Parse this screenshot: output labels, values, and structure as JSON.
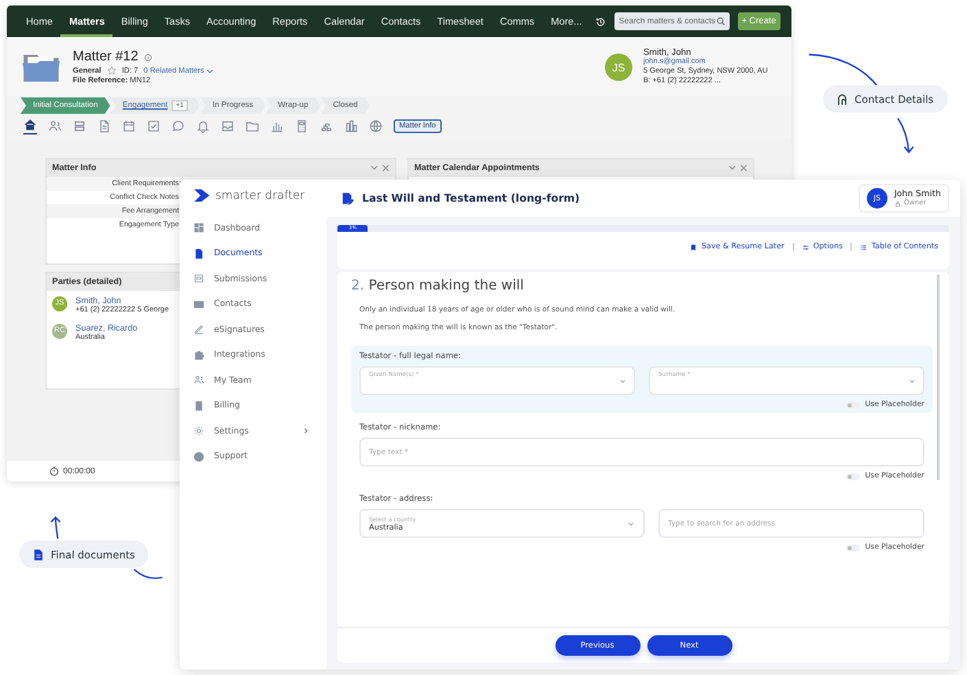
{
  "crm": {
    "nav": [
      {
        "label": "Home",
        "selected": false
      },
      {
        "label": "Matters",
        "selected": true
      },
      {
        "label": "Billing",
        "selected": false
      },
      {
        "label": "Tasks",
        "selected": false
      },
      {
        "label": "Accounting",
        "selected": false
      },
      {
        "label": "Reports",
        "selected": false
      },
      {
        "label": "Calendar",
        "selected": false
      },
      {
        "label": "Contacts",
        "selected": false
      },
      {
        "label": "Timesheet",
        "selected": false
      },
      {
        "label": "Comms",
        "selected": false
      },
      {
        "label": "More...",
        "selected": false
      }
    ],
    "search": {
      "placeholder": "Search matters & contacts"
    },
    "create_button": "+ Create",
    "matter": {
      "title": "Matter #12",
      "type": "General",
      "id": "ID: 7",
      "related": "0 Related Matters",
      "file_reference": "**File Reference:** MN12"
    },
    "contact": {
      "initials": "JS",
      "name": "Smith, John",
      "email": "john.s@gmail.com",
      "address": "5 George St, Sydney, NSW 2000, AU",
      "phone": "B: +61 (2) 22222222 ..."
    },
    "stages": [
      {
        "label": "Initial Consultation",
        "selected": true,
        "link": false
      },
      {
        "label": "Engagement",
        "selected": false,
        "link": true,
        "badge": "+1"
      },
      {
        "label": "In Progress",
        "selected": false,
        "link": false
      },
      {
        "label": "Wrap-up",
        "selected": false,
        "link": false
      },
      {
        "label": "Closed",
        "selected": false,
        "link": false
      }
    ],
    "toolbar_tabs": [
      {
        "selected": true
      },
      {
        "selected": false
      },
      {
        "selected": false
      },
      {
        "selected": false
      },
      {
        "selected": false
      },
      {
        "selected": false
      },
      {
        "selected": false
      },
      {
        "selected": false
      },
      {
        "selected": false
      },
      {
        "selected": false
      },
      {
        "selected": false
      },
      {
        "selected": false
      },
      {
        "selected": false
      },
      {
        "selected": false
      },
      {
        "selected": false
      }
    ],
    "matter_info_button": "Matter Info",
    "matter_info": {
      "title": "Matter Info",
      "rows": [
        "Client Requirements:",
        "Conflict Check Notes:",
        "Fee Arrangement:",
        "Engagement Type:"
      ]
    },
    "calendar_panel": {
      "title": "Matter Calendar Appointments"
    },
    "parties": {
      "title": "Parties (detailed)",
      "items": [
        {
          "initials": "JS",
          "name": "Smith, John",
          "detail": "+61 (2) 22222222 5 George",
          "color": "#8db33a"
        },
        {
          "initials": "RC",
          "name": "Suarez, Ricardo",
          "detail": "Australia",
          "color": "#a3b98e"
        }
      ]
    },
    "timer": "00:00:00"
  },
  "drafter": {
    "brand": "smarter drafter",
    "sidebar": [
      {
        "label": "Dashboard",
        "selected": false,
        "submenu": false
      },
      {
        "label": "Documents",
        "selected": true,
        "submenu": false
      },
      {
        "label": "Submissions",
        "selected": false,
        "submenu": false
      },
      {
        "label": "Contacts",
        "selected": false,
        "submenu": false
      },
      {
        "label": "eSignatures",
        "selected": false,
        "submenu": false
      },
      {
        "label": "Integrations",
        "selected": false,
        "submenu": false
      },
      {
        "label": "My Team",
        "selected": false,
        "submenu": false
      },
      {
        "label": "Billing",
        "selected": false,
        "submenu": false
      },
      {
        "label": "Settings",
        "selected": false,
        "submenu": true
      },
      {
        "label": "Support",
        "selected": false,
        "submenu": false
      }
    ],
    "document_title": "Last Will and Testament (long-form)",
    "user": {
      "initials": "JS",
      "name": "John Smith",
      "role": "Owner"
    },
    "progress": {
      "label": "3%",
      "level": 0.03
    },
    "actions": [
      "Save & Resume Later",
      "Options",
      "Table of Contents"
    ],
    "section": {
      "number": "2.",
      "title": "Person making the will"
    },
    "paragraphs": [
      "Only an individual 18 years of age or older who is of sound mind can make a valid will.",
      "The person making the will is known as the \"Testator\"."
    ],
    "groups": [
      {
        "label": "Testator - full legal name:",
        "highlighted": true,
        "fields": [
          {
            "kind": "select",
            "placeholder": "Given Name(s) *"
          },
          {
            "kind": "select",
            "placeholder": "Surname *"
          }
        ],
        "toggle": {
          "label": "Use Placeholder",
          "on": false
        }
      },
      {
        "label": "Testator - nickname:",
        "highlighted": false,
        "fields": [
          {
            "kind": "text",
            "placeholder": "Type text *"
          }
        ],
        "toggle": {
          "label": "Use Placeholder",
          "on": false
        }
      },
      {
        "label": "Testator - address:",
        "highlighted": false,
        "fields": [
          {
            "kind": "country",
            "label": "Select a country",
            "value": "Australia"
          },
          {
            "kind": "text",
            "placeholder": "Type to search for an address"
          }
        ],
        "toggle": {
          "label": "Use Placeholder",
          "on": false
        }
      }
    ],
    "buttons": [
      "Previous",
      "Next"
    ]
  },
  "callouts": [
    "Contact Details",
    "Final documents"
  ]
}
